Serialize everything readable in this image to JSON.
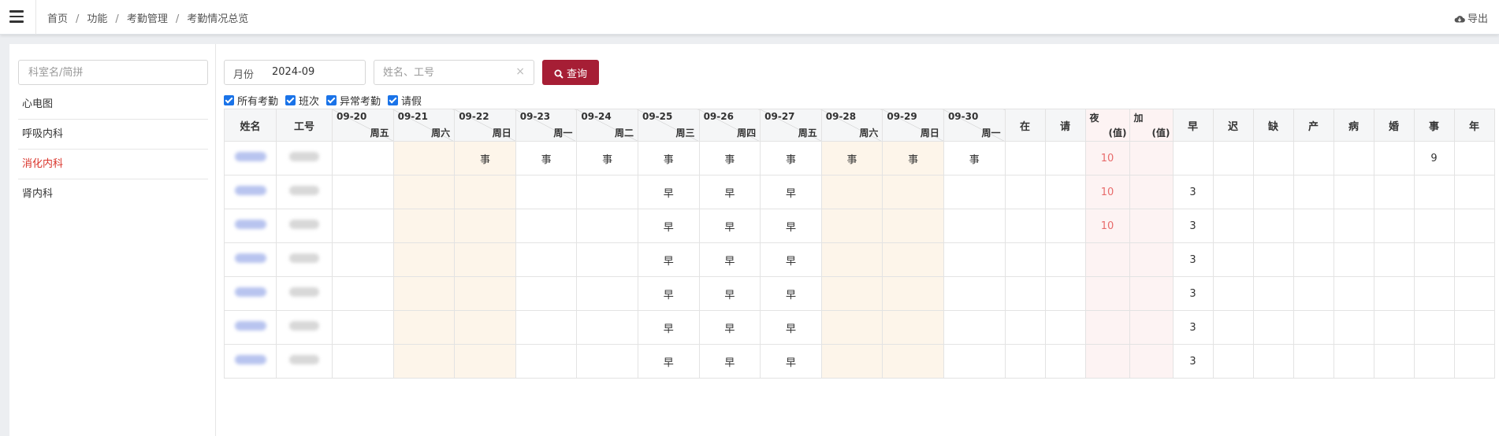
{
  "topbar": {
    "breadcrumb": [
      "首页",
      "功能",
      "考勤管理",
      "考勤情况总览"
    ],
    "export_label": "导出"
  },
  "sidebar": {
    "search_placeholder": "科室名/简拼",
    "departments": [
      {
        "label": "心电图",
        "active": false
      },
      {
        "label": "呼吸内科",
        "active": false
      },
      {
        "label": "消化内科",
        "active": true
      },
      {
        "label": "肾内科",
        "active": false
      }
    ]
  },
  "toolbar": {
    "month_label": "月份",
    "month_value": "2024-09",
    "name_placeholder": "姓名、工号",
    "clear_icon": "×",
    "query_label": "查询",
    "query_color": "#a61e35"
  },
  "filters": [
    {
      "label": "所有考勤",
      "checked": true
    },
    {
      "label": "班次",
      "checked": true
    },
    {
      "label": "异常考勤",
      "checked": true
    },
    {
      "label": "请假",
      "checked": true
    }
  ],
  "table": {
    "headers": {
      "name": "姓名",
      "id": "工号",
      "dates": [
        {
          "date": "09-20",
          "weekday": "周五"
        },
        {
          "date": "09-21",
          "weekday": "周六"
        },
        {
          "date": "09-22",
          "weekday": "周日"
        },
        {
          "date": "09-23",
          "weekday": "周一"
        },
        {
          "date": "09-24",
          "weekday": "周二"
        },
        {
          "date": "09-25",
          "weekday": "周三"
        },
        {
          "date": "09-26",
          "weekday": "周四"
        },
        {
          "date": "09-27",
          "weekday": "周五"
        },
        {
          "date": "09-28",
          "weekday": "周六"
        },
        {
          "date": "09-29",
          "weekday": "周日"
        },
        {
          "date": "09-30",
          "weekday": "周一"
        }
      ],
      "zai": "在",
      "qing": "请",
      "ye": {
        "top": "夜",
        "bottom": "(值)"
      },
      "jia": {
        "top": "加",
        "bottom": "(值)"
      },
      "summary": [
        "早",
        "迟",
        "缺",
        "产",
        "病",
        "婚",
        "事",
        "年"
      ]
    },
    "weekend_columns": [
      1,
      2,
      8,
      9
    ],
    "highlight_color": "#e86b6b",
    "rows": [
      {
        "dates": [
          "",
          "",
          "事",
          "事",
          "事",
          "事",
          "事",
          "事",
          "事",
          "事",
          "事"
        ],
        "zai": "",
        "qing": "",
        "ye": "10",
        "jia": "",
        "summary": [
          "",
          "",
          "",
          "",
          "",
          "",
          "9",
          ""
        ]
      },
      {
        "dates": [
          "",
          "",
          "",
          "",
          "",
          "早",
          "早",
          "早",
          "",
          "",
          ""
        ],
        "zai": "",
        "qing": "",
        "ye": "10",
        "jia": "",
        "summary": [
          "3",
          "",
          "",
          "",
          "",
          "",
          "",
          ""
        ]
      },
      {
        "dates": [
          "",
          "",
          "",
          "",
          "",
          "早",
          "早",
          "早",
          "",
          "",
          ""
        ],
        "zai": "",
        "qing": "",
        "ye": "10",
        "jia": "",
        "summary": [
          "3",
          "",
          "",
          "",
          "",
          "",
          "",
          ""
        ]
      },
      {
        "dates": [
          "",
          "",
          "",
          "",
          "",
          "早",
          "早",
          "早",
          "",
          "",
          ""
        ],
        "zai": "",
        "qing": "",
        "ye": "",
        "jia": "",
        "summary": [
          "3",
          "",
          "",
          "",
          "",
          "",
          "",
          ""
        ]
      },
      {
        "dates": [
          "",
          "",
          "",
          "",
          "",
          "早",
          "早",
          "早",
          "",
          "",
          ""
        ],
        "zai": "",
        "qing": "",
        "ye": "",
        "jia": "",
        "summary": [
          "3",
          "",
          "",
          "",
          "",
          "",
          "",
          ""
        ]
      },
      {
        "dates": [
          "",
          "",
          "",
          "",
          "",
          "早",
          "早",
          "早",
          "",
          "",
          ""
        ],
        "zai": "",
        "qing": "",
        "ye": "",
        "jia": "",
        "summary": [
          "3",
          "",
          "",
          "",
          "",
          "",
          "",
          ""
        ]
      },
      {
        "dates": [
          "",
          "",
          "",
          "",
          "",
          "早",
          "早",
          "早",
          "",
          "",
          ""
        ],
        "zai": "",
        "qing": "",
        "ye": "",
        "jia": "",
        "summary": [
          "3",
          "",
          "",
          "",
          "",
          "",
          "",
          ""
        ]
      }
    ]
  }
}
